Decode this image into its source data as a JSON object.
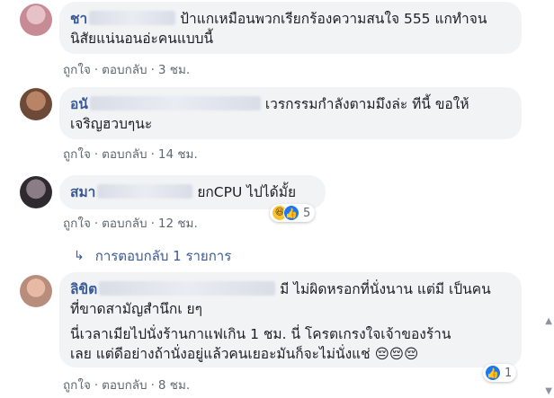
{
  "comments": [
    {
      "author_visible": "ชา",
      "text_lines": [
        "ป้าแกเหมือนพวกเรียกร้องความสนใจ 555 แกทำจน",
        "นิสัยแน่นอนอ่ะคนแบบนี้"
      ],
      "actions": {
        "like": "ถูกใจ",
        "reply": "ตอบกลับ",
        "time": "3 ชม."
      }
    },
    {
      "author_visible": "อนั",
      "text_lines": [
        "เวรกรรมกำลังตามมึงล่ะ ทีนี้ ขอให้",
        "เจริญฮวบๆนะ"
      ],
      "actions": {
        "like": "ถูกใจ",
        "reply": "ตอบกลับ",
        "time": "14 ชม."
      }
    },
    {
      "author_visible": "สมา",
      "text_lines": [
        "ยกCPU ไปได้มั้ย"
      ],
      "actions": {
        "like": "ถูกใจ",
        "reply": "ตอบกลับ",
        "time": "12 ชม."
      },
      "reactions": {
        "icons": [
          "haha-icon",
          "like-icon"
        ],
        "count": "5"
      }
    },
    {
      "author_visible": "ลิขิต",
      "text_lines": [
        "มี ไม่ผิดหรอกที่นั่งนาน แต่มี เป็นคน",
        "ที่ขาดสามัญสำนึกเ ยๆ"
      ],
      "text_lines_2": [
        "นี่เวลาเมียไปนั่งร้านกาแฟเกิน 1 ชม. นี่ โครตเกรงใจเจ้าของร้าน",
        "เลย แต่ดีอย่างถ้านั่งอยู่แล้วคนเยอะมันก็จะไม่นั่งแช่ 😔😔😔"
      ],
      "actions": {
        "like": "ถูกใจ",
        "reply": "ตอบกลับ",
        "time": "8 ชม."
      },
      "reactions": {
        "icons": [
          "like-icon"
        ],
        "count": "1"
      }
    }
  ],
  "replies_link": "การตอบกลับ 1 รายการ",
  "colors": {
    "author": "#385898",
    "bubble": "#f2f3f5",
    "meta": "#606770",
    "like": "#1877f2",
    "haha": "#f7c331"
  }
}
